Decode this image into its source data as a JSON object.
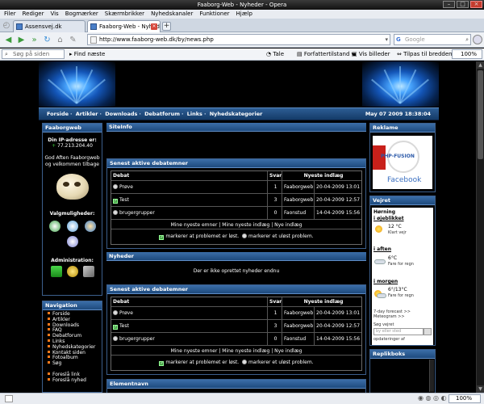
{
  "window": {
    "title": "Faaborg-Web - Nyheder - Opera"
  },
  "menu": [
    "Filer",
    "Rediger",
    "Vis",
    "Bogmærker",
    "Skærmbrikker",
    "Nyhedskanaler",
    "Funktioner",
    "Hjælp"
  ],
  "tabs": [
    {
      "label": "Assensvej.dk",
      "active": false
    },
    {
      "label": "Faaborg-Web - Nyheder",
      "active": true
    }
  ],
  "address": {
    "url": "http://www.faaborg-web.dk/by/news.php"
  },
  "search": {
    "placeholder": "Google"
  },
  "findbar": {
    "search_placeholder": "Søg på siden",
    "find_next": "Find næste",
    "speak": "Tale",
    "author_mode": "Forfattertilstand",
    "show_images": "Vis billeder",
    "fit_width": "Tilpas til bredden",
    "zoom": "100%"
  },
  "site": {
    "nav_links": [
      "Forside",
      "Artikler",
      "Downloads",
      "Debatforum",
      "Links",
      "Nyhedskategorier"
    ],
    "date": "May 07 2009 18:38:04",
    "left": {
      "faaborgweb_title": "Faaborgweb",
      "ip_label": "Din IP-adresse er:",
      "ip_value": "77.213.204.40",
      "greeting": "God Aften Faaborgweb og velkommen tilbage",
      "options_label": "Valgmuligheder:",
      "admin_label": "Administration:",
      "navigation_title": "Navigation",
      "nav_items": [
        "Forside",
        "Artikler",
        "Downloads",
        "FAQ",
        "Debatforum",
        "Links",
        "Nyhedskategorier",
        "Kontakt siden",
        "Fotoalbum",
        "Søg"
      ],
      "extra_items": [
        "Foreslå link",
        "Foreslå nyhed"
      ]
    },
    "center": {
      "siteinfo_title": "SiteInfo",
      "forum_title": "Senest aktive debatemner",
      "table_headers": [
        "Debat",
        "Svar",
        "Nyeste indlæg"
      ],
      "rows": [
        {
          "icon": "bulb",
          "topic": "Prøve",
          "replies": "1",
          "user": "Faaborgweb",
          "date": "20-04-2009 13:01"
        },
        {
          "icon": "check",
          "topic": "Test",
          "replies": "3",
          "user": "Faaborgweb",
          "date": "20-04-2009 12:57"
        },
        {
          "icon": "bulb",
          "topic": "brugergrupper",
          "replies": "0",
          "user": "Faonstud",
          "date": "14-04-2009 15:56"
        }
      ],
      "forum_links": "Mine nyeste emner | Mine nyeste indlæg | Nye indlæg",
      "legend_solved": "markerer at problemet er løst.",
      "legend_unsolved": "markerer et uløst problem.",
      "news_title": "Nyheder",
      "news_empty": "Der er ikke oprettet nyheder endnu",
      "element_title": "Elementnavn"
    },
    "right": {
      "ads_title": "Reklame",
      "ad_logo_text": "PHP-FUSION",
      "ad_facebook": "Facebook",
      "weather_title": "Vejret",
      "weather_city": "Hørning",
      "now_label": "i øjeblikket",
      "now_temp": "12 °C",
      "now_desc": "Klart vejr",
      "evening_label": "i aften",
      "evening_temp": "6°C",
      "evening_desc": "Fare for regn",
      "tomorrow_label": "i morgen",
      "tomorrow_temp": "6°/13°C",
      "tomorrow_desc": "Fare for regn",
      "forecast_link": "7-day forecast >>",
      "meteogram_link": "Meteogram >>",
      "search_weather": "Søg vejret",
      "search_placeholder": "by eller sted",
      "updated": "opdateringer af",
      "shoutbox_title": "Replikboks"
    }
  }
}
